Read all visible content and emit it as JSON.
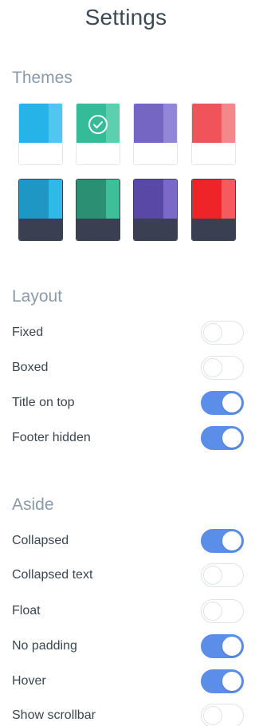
{
  "header": {
    "title": "Settings"
  },
  "themes": {
    "title": "Themes",
    "swatches": [
      {
        "main": "#26b4e8",
        "side": "#4fc7ef",
        "bottom": "#ffffff",
        "selected": false
      },
      {
        "main": "#34bb98",
        "side": "#5ccfae",
        "bottom": "#ffffff",
        "selected": true
      },
      {
        "main": "#7566c4",
        "side": "#9287d4",
        "bottom": "#ffffff",
        "selected": false
      },
      {
        "main": "#f0545a",
        "side": "#f4878a",
        "bottom": "#ffffff",
        "selected": false
      },
      {
        "main": "#1e97c4",
        "side": "#2dbbe6",
        "bottom": "#3a3f51",
        "selected": false
      },
      {
        "main": "#2b8f74",
        "side": "#3dbf99",
        "bottom": "#3a3f51",
        "selected": false
      },
      {
        "main": "#5a48a6",
        "side": "#7b69c7",
        "bottom": "#3a3f51",
        "selected": false
      },
      {
        "main": "#ee2429",
        "side": "#f35b5f",
        "bottom": "#3a3f51",
        "selected": false
      }
    ]
  },
  "layout": {
    "title": "Layout",
    "options": [
      {
        "label": "Fixed",
        "on": false
      },
      {
        "label": "Boxed",
        "on": false
      },
      {
        "label": "Title on top",
        "on": true
      },
      {
        "label": "Footer hidden",
        "on": true
      }
    ]
  },
  "aside": {
    "title": "Aside",
    "options": [
      {
        "label": "Collapsed",
        "on": true
      },
      {
        "label": "Collapsed text",
        "on": false
      },
      {
        "label": "Float",
        "on": false
      },
      {
        "label": "No padding",
        "on": true
      },
      {
        "label": "Hover",
        "on": true
      },
      {
        "label": "Show scrollbar",
        "on": false
      }
    ]
  },
  "colors": {
    "accent": "#5b8ee8",
    "check_icon": "check-circle-icon"
  }
}
